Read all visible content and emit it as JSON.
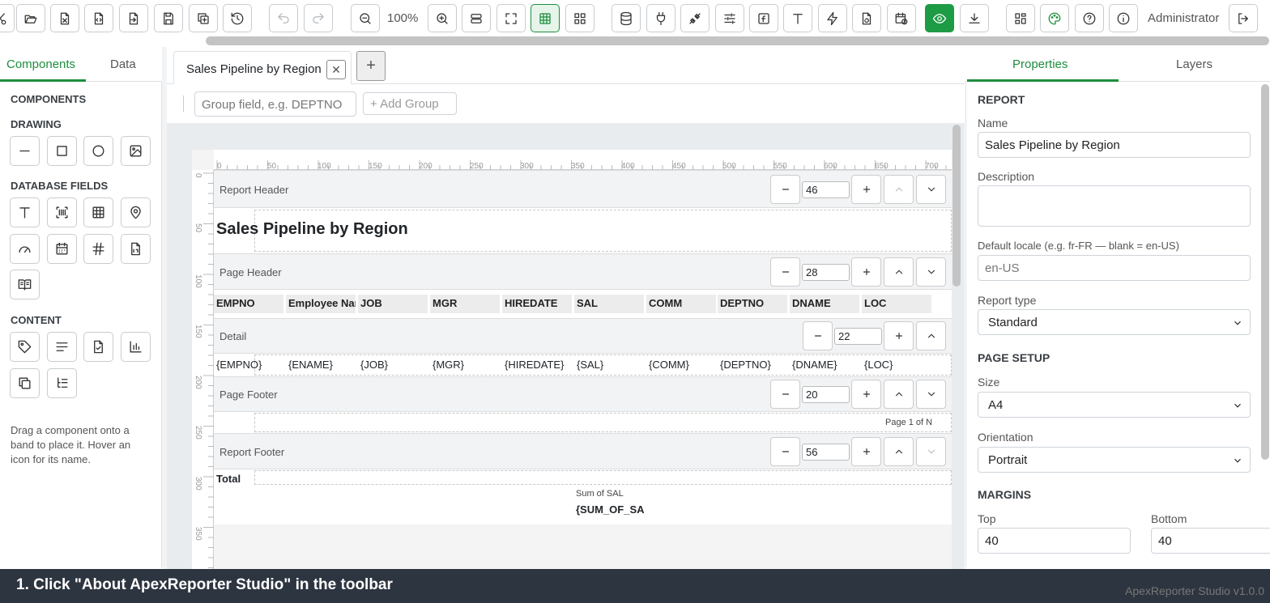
{
  "toolbar": {
    "zoom": "100%",
    "user": "Administrator"
  },
  "left_tabs": [
    "Components",
    "Data"
  ],
  "left": {
    "components_title": "COMPONENTS",
    "drawing_title": "DRAWING",
    "dbfields_title": "DATABASE FIELDS",
    "content_title": "CONTENT",
    "hint": "Drag a component onto a band to place it. Hover an icon for its name."
  },
  "doc_tab": {
    "title": "Sales Pipeline by Region",
    "close": "✕",
    "add": "+"
  },
  "group_bar": {
    "placeholder": "Group field, e.g. DEPTNO",
    "add_label": "+  Add Group"
  },
  "ruler": {
    "top": [
      "0",
      "50",
      "100",
      "150",
      "200",
      "250",
      "300",
      "350",
      "400",
      "450",
      "500",
      "550",
      "600",
      "650",
      "700"
    ],
    "left": [
      "0",
      "50",
      "100",
      "150",
      "200",
      "250",
      "300",
      "350"
    ]
  },
  "bands": {
    "report_header": {
      "name": "Report Header",
      "height": "46"
    },
    "page_header": {
      "name": "Page Header",
      "height": "28"
    },
    "detail": {
      "name": "Detail",
      "height": "22"
    },
    "page_footer": {
      "name": "Page Footer",
      "height": "20"
    },
    "report_footer": {
      "name": "Report Footer",
      "height": "56"
    }
  },
  "report": {
    "title": "Sales Pipeline by Region",
    "headers": [
      "EMPNO",
      "Employee Nan",
      "JOB",
      "MGR",
      "HIREDATE",
      "SAL",
      "COMM",
      "DEPTNO",
      "DNAME",
      "LOC"
    ],
    "fields": [
      "{EMPNO}",
      "{ENAME}",
      "{JOB}",
      "{MGR}",
      "{HIREDATE}",
      "{SAL}",
      "{COMM}",
      "{DEPTNO}",
      "{DNAME}",
      "{LOC}"
    ],
    "page_label": "Page 1 of N",
    "total_label": "Total",
    "sum_label": "Sum of SAL",
    "sum_field": "{SUM_OF_SA"
  },
  "right_tabs": [
    "Properties",
    "Layers"
  ],
  "properties": {
    "report_title": "REPORT",
    "name_label": "Name",
    "name_value": "Sales Pipeline by Region",
    "description_label": "Description",
    "description_value": "",
    "locale_label": "Default locale (e.g. fr-FR — blank = en-US)",
    "locale_placeholder": "en-US",
    "report_type_label": "Report type",
    "report_type": "Standard",
    "page_setup_title": "PAGE SETUP",
    "size_label": "Size",
    "size": "A4",
    "orientation_label": "Orientation",
    "orientation": "Portrait",
    "margins_title": "MARGINS",
    "top_label": "Top",
    "top_value": "40",
    "bottom_label": "Bottom",
    "bottom_value": "40"
  },
  "status": {
    "instruction": "1. Click \"About ApexReporter Studio\" in the toolbar",
    "version": "ApexReporter Studio v1.0.0"
  }
}
